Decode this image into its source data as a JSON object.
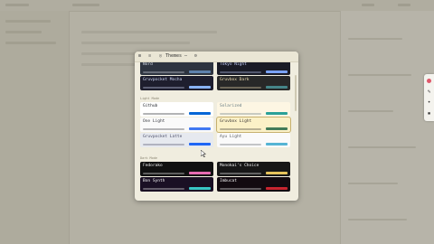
{
  "panel": {
    "title": "Themes",
    "icons": [
      "grid-icon",
      "list-icon",
      "palette-icon",
      "ellipsis-icon",
      "gear-icon"
    ]
  },
  "sections": [
    {
      "label": "Light Mode"
    },
    {
      "label": "Dark Mode"
    }
  ],
  "themes": [
    {
      "name": "Nord",
      "bg": "#2e3440",
      "fg": "#d8dee9",
      "swatch": "#5e81ac",
      "selected": false
    },
    {
      "name": "Tokyo Night",
      "bg": "#1a1b26",
      "fg": "#c0caf5",
      "swatch": "#7aa2f7",
      "selected": false
    },
    {
      "name": "Gruvpocket Mocha",
      "bg": "#1e1e2e",
      "fg": "#cdd6f4",
      "swatch": "#89b4fa",
      "selected": false
    },
    {
      "name": "Gruvbox Dark",
      "bg": "#282828",
      "fg": "#ebdbb2",
      "swatch": "#458588",
      "selected": false
    },
    {
      "name": "Github",
      "bg": "#ffffff",
      "fg": "#24292e",
      "swatch": "#0366d6",
      "selected": false
    },
    {
      "name": "Solarized",
      "bg": "#fdf6e3",
      "fg": "#657b83",
      "swatch": "#2aa198",
      "selected": false
    },
    {
      "name": "One Light",
      "bg": "#fafafa",
      "fg": "#383a42",
      "swatch": "#4078f2",
      "selected": false
    },
    {
      "name": "Gruvbox Light",
      "bg": "#fbf1c7",
      "fg": "#3c3836",
      "swatch": "#427b58",
      "selected": true
    },
    {
      "name": "Gruvpocket Latte",
      "bg": "#e6e9ef",
      "fg": "#4c4f69",
      "swatch": "#1e66f5",
      "selected": false
    },
    {
      "name": "Ayu Light",
      "bg": "#fafafa",
      "fg": "#5c6166",
      "swatch": "#55b4d4",
      "selected": false
    },
    {
      "name": "Fedorako",
      "bg": "#111111",
      "fg": "#f2f2f2",
      "swatch": "#e66bb2",
      "selected": false
    },
    {
      "name": "Monokai's Choice",
      "bg": "#171717",
      "fg": "#f2f2f2",
      "swatch": "#e6c35c",
      "selected": false
    },
    {
      "name": "Bon Synth",
      "bg": "#1a1024",
      "fg": "#f2f2f2",
      "swatch": "#39c6c6",
      "selected": false
    },
    {
      "name": "Imbucat",
      "bg": "#120a10",
      "fg": "#f2f2f2",
      "swatch": "#c8242f",
      "selected": false
    }
  ]
}
